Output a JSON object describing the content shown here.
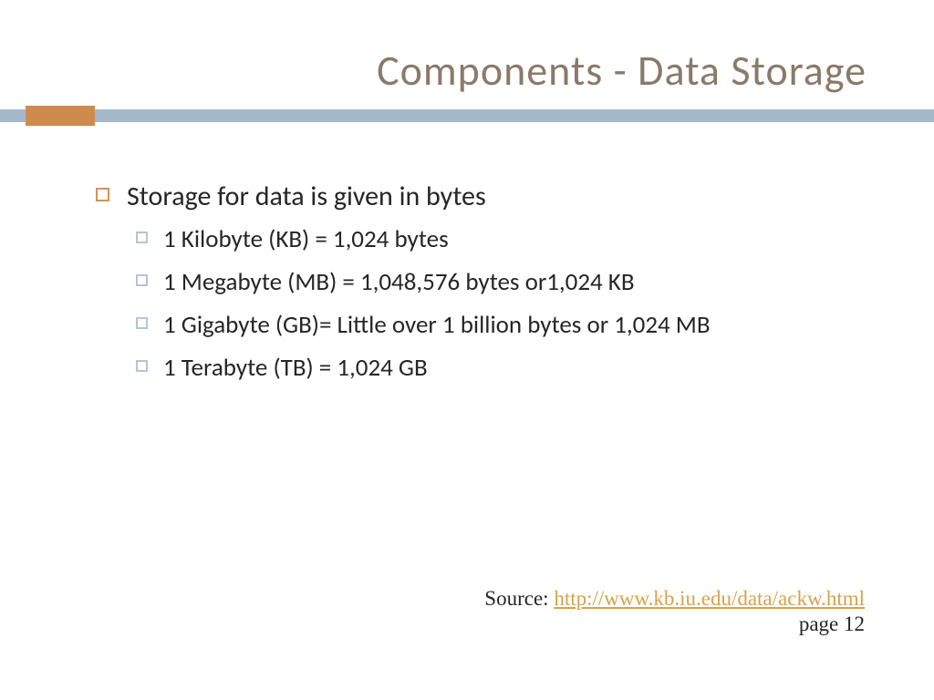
{
  "title": "Components - Data Storage",
  "main": {
    "heading": "Storage for data is given in bytes",
    "items": [
      "1 Kilobyte (KB) = 1,024 bytes",
      "1 Megabyte (MB) = 1,048,576 bytes or1,024 KB",
      "1 Gigabyte (GB)= Little over 1 billion bytes or 1,024 MB",
      "1 Terabyte (TB) = 1,024 GB"
    ]
  },
  "footer": {
    "source_label": "Source: ",
    "source_url_text": "http://www.kb.iu.edu/data/ackw.html",
    "source_url_href": "http://www.kb.iu.edu/data/ackw.html",
    "page_label": "page 12"
  }
}
